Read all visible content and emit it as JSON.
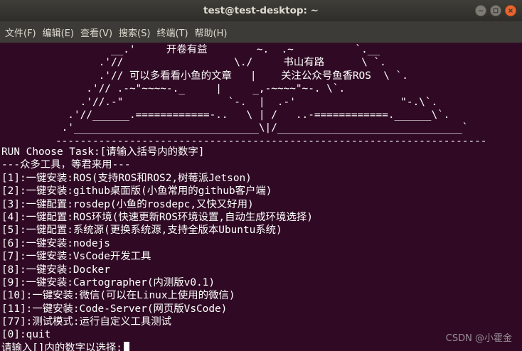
{
  "window": {
    "title": "test@test-desktop: ~",
    "controls": [
      "minimize-icon",
      "maximize-icon",
      "close-icon"
    ],
    "accent_colors": {
      "close": "#e9662e",
      "terminal_bg": "#300a24",
      "titlebar": "#2e2d29"
    }
  },
  "menubar": {
    "items": [
      "文件(F)",
      "编辑(E)",
      "查看(V)",
      "搜索(S)",
      "终端(T)",
      "帮助(H)"
    ]
  },
  "terminal": {
    "banner": "                  __.'     开卷有益        ~.  .~          `.__\n                .'//                  \\./     书山有路      \\ `.\n                .'// 可以多看看小鱼的文章   |    关注公众号鱼香ROS  \\ `.\n              .'// .-~\"~~~~-._     |     _,-~~~~\"~-. \\`.\n             .'//.-\"                 `-.  |  .-'                 \"-.\\`.\n           .'//______.============-..   \\ | /   ..-============.______\\`.\n          .'______________________________\\|/______________________________`\n         ----------------------------------------------------------------------",
    "lines": [
      "RUN Choose Task:[请输入括号内的数字]",
      "---众多工具，等君来用---",
      "[1]:一键安装:ROS(支持ROS和ROS2,树莓派Jetson)",
      "[2]:一键安装:github桌面版(小鱼常用的github客户端)",
      "[3]:一键配置:rosdep(小鱼的rosdepc,又快又好用)",
      "[4]:一键配置:ROS环境(快速更新ROS环境设置,自动生成环境选择)",
      "[5]:一键配置:系统源(更换系统源,支持全版本Ubuntu系统)",
      "[6]:一键安装:nodejs",
      "[7]:一键安装:VsCode开发工具",
      "[8]:一键安装:Docker",
      "[9]:一键安装:Cartographer(内测版v0.1)",
      "[10]:一键安装:微信(可以在Linux上使用的微信)",
      "[11]:一键安装:Code-Server(网页版VsCode)",
      "[77]:测试模式:运行自定义工具测试",
      "[0]:quit"
    ],
    "prompt": "请输入[]内的数字以选择:"
  },
  "watermark": "CSDN @小霍金"
}
